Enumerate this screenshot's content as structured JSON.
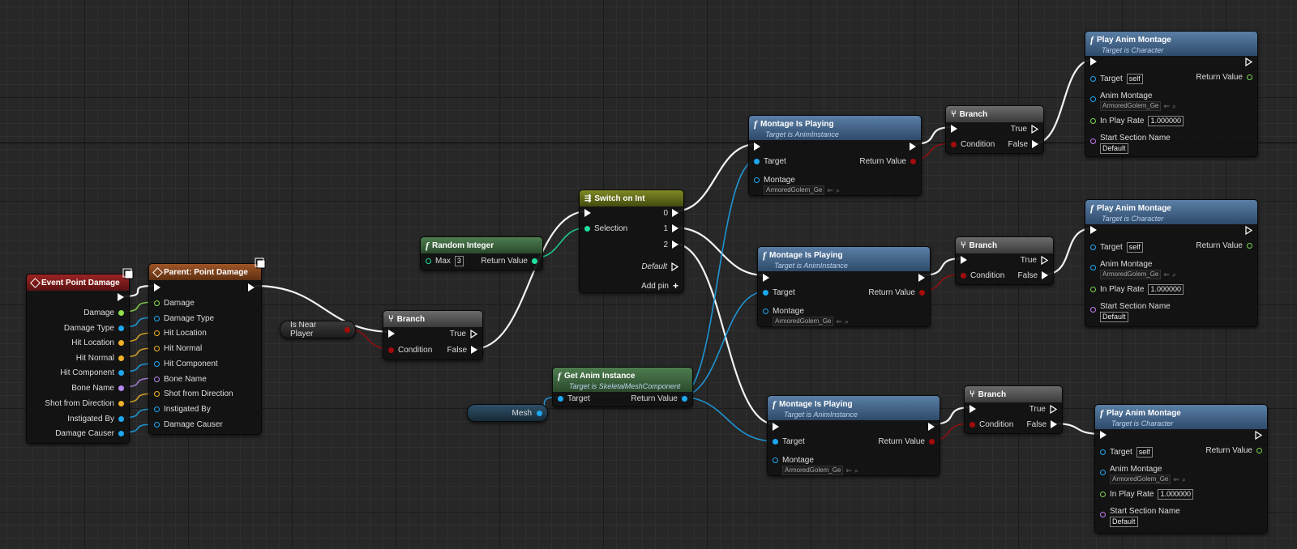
{
  "nodes": {
    "event_point_damage": {
      "title": "Event Point Damage",
      "outputs": [
        "Damage",
        "Damage Type",
        "Hit Location",
        "Hit Normal",
        "Hit Component",
        "Bone Name",
        "Shot from Direction",
        "Instigated By",
        "Damage Causer"
      ]
    },
    "parent_point_damage": {
      "title": "Parent: Point Damage",
      "inputs": [
        "Damage",
        "Damage Type",
        "Hit Location",
        "Hit Normal",
        "Hit Component",
        "Bone Name",
        "Shot from Direction",
        "Instigated By",
        "Damage Causer"
      ]
    },
    "is_near_player": {
      "label": "Is Near Player"
    },
    "branch_main": {
      "title": "Branch",
      "true_label": "True",
      "false_label": "False",
      "condition_label": "Condition"
    },
    "random_integer": {
      "title": "Random Integer",
      "max_label": "Max",
      "max_value": "3",
      "return_label": "Return Value"
    },
    "switch_on_int": {
      "title": "Switch on Int",
      "selection_label": "Selection",
      "cases": [
        "0",
        "1",
        "2"
      ],
      "default_label": "Default",
      "add_pin_label": "Add pin"
    },
    "mesh_var": {
      "label": "Mesh"
    },
    "get_anim_instance": {
      "title": "Get Anim Instance",
      "subtitle": "Target is SkeletalMeshComponent",
      "target_label": "Target",
      "return_label": "Return Value"
    },
    "montage_playing": [
      {
        "title": "Montage Is Playing",
        "subtitle": "Target is AnimInstance",
        "target_label": "Target",
        "return_label": "Return Value",
        "montage_label": "Montage",
        "montage_value": "ArmoredGolem_Ge"
      },
      {
        "title": "Montage Is Playing",
        "subtitle": "Target is AnimInstance",
        "target_label": "Target",
        "return_label": "Return Value",
        "montage_label": "Montage",
        "montage_value": "ArmoredGolem_Ge"
      },
      {
        "title": "Montage Is Playing",
        "subtitle": "Target is AnimInstance",
        "target_label": "Target",
        "return_label": "Return Value",
        "montage_label": "Montage",
        "montage_value": "ArmoredGolem_Ge"
      }
    ],
    "branches": [
      {
        "title": "Branch",
        "true_label": "True",
        "false_label": "False",
        "condition_label": "Condition"
      },
      {
        "title": "Branch",
        "true_label": "True",
        "false_label": "False",
        "condition_label": "Condition"
      },
      {
        "title": "Branch",
        "true_label": "True",
        "false_label": "False",
        "condition_label": "Condition"
      }
    ],
    "play_anim_montage": [
      {
        "title": "Play Anim Montage",
        "subtitle": "Target is Character",
        "target_label": "Target",
        "target_value": "self",
        "return_label": "Return Value",
        "montage_label": "Anim Montage",
        "montage_value": "ArmoredGolem_Ge",
        "rate_label": "In Play Rate",
        "rate_value": "1.000000",
        "section_label": "Start Section Name",
        "section_value": "Default"
      },
      {
        "title": "Play Anim Montage",
        "subtitle": "Target is Character",
        "target_label": "Target",
        "target_value": "self",
        "return_label": "Return Value",
        "montage_label": "Anim Montage",
        "montage_value": "ArmoredGolem_Ge",
        "rate_label": "In Play Rate",
        "rate_value": "1.000000",
        "section_label": "Start Section Name",
        "section_value": "Default"
      },
      {
        "title": "Play Anim Montage",
        "subtitle": "Target is Character",
        "target_label": "Target",
        "target_value": "self",
        "return_label": "Return Value",
        "montage_label": "Anim Montage",
        "montage_value": "ArmoredGolem_Ge",
        "rate_label": "In Play Rate",
        "rate_value": "1.000000",
        "section_label": "Start Section Name",
        "section_value": "Default"
      }
    ]
  },
  "colors": {
    "exec": "#ffffff",
    "float": "#8fe14c",
    "object": "#1da8f2",
    "struct": "#f0b226",
    "name": "#b589f0",
    "bool": "#a30c0c",
    "int": "#1ee0a0"
  }
}
